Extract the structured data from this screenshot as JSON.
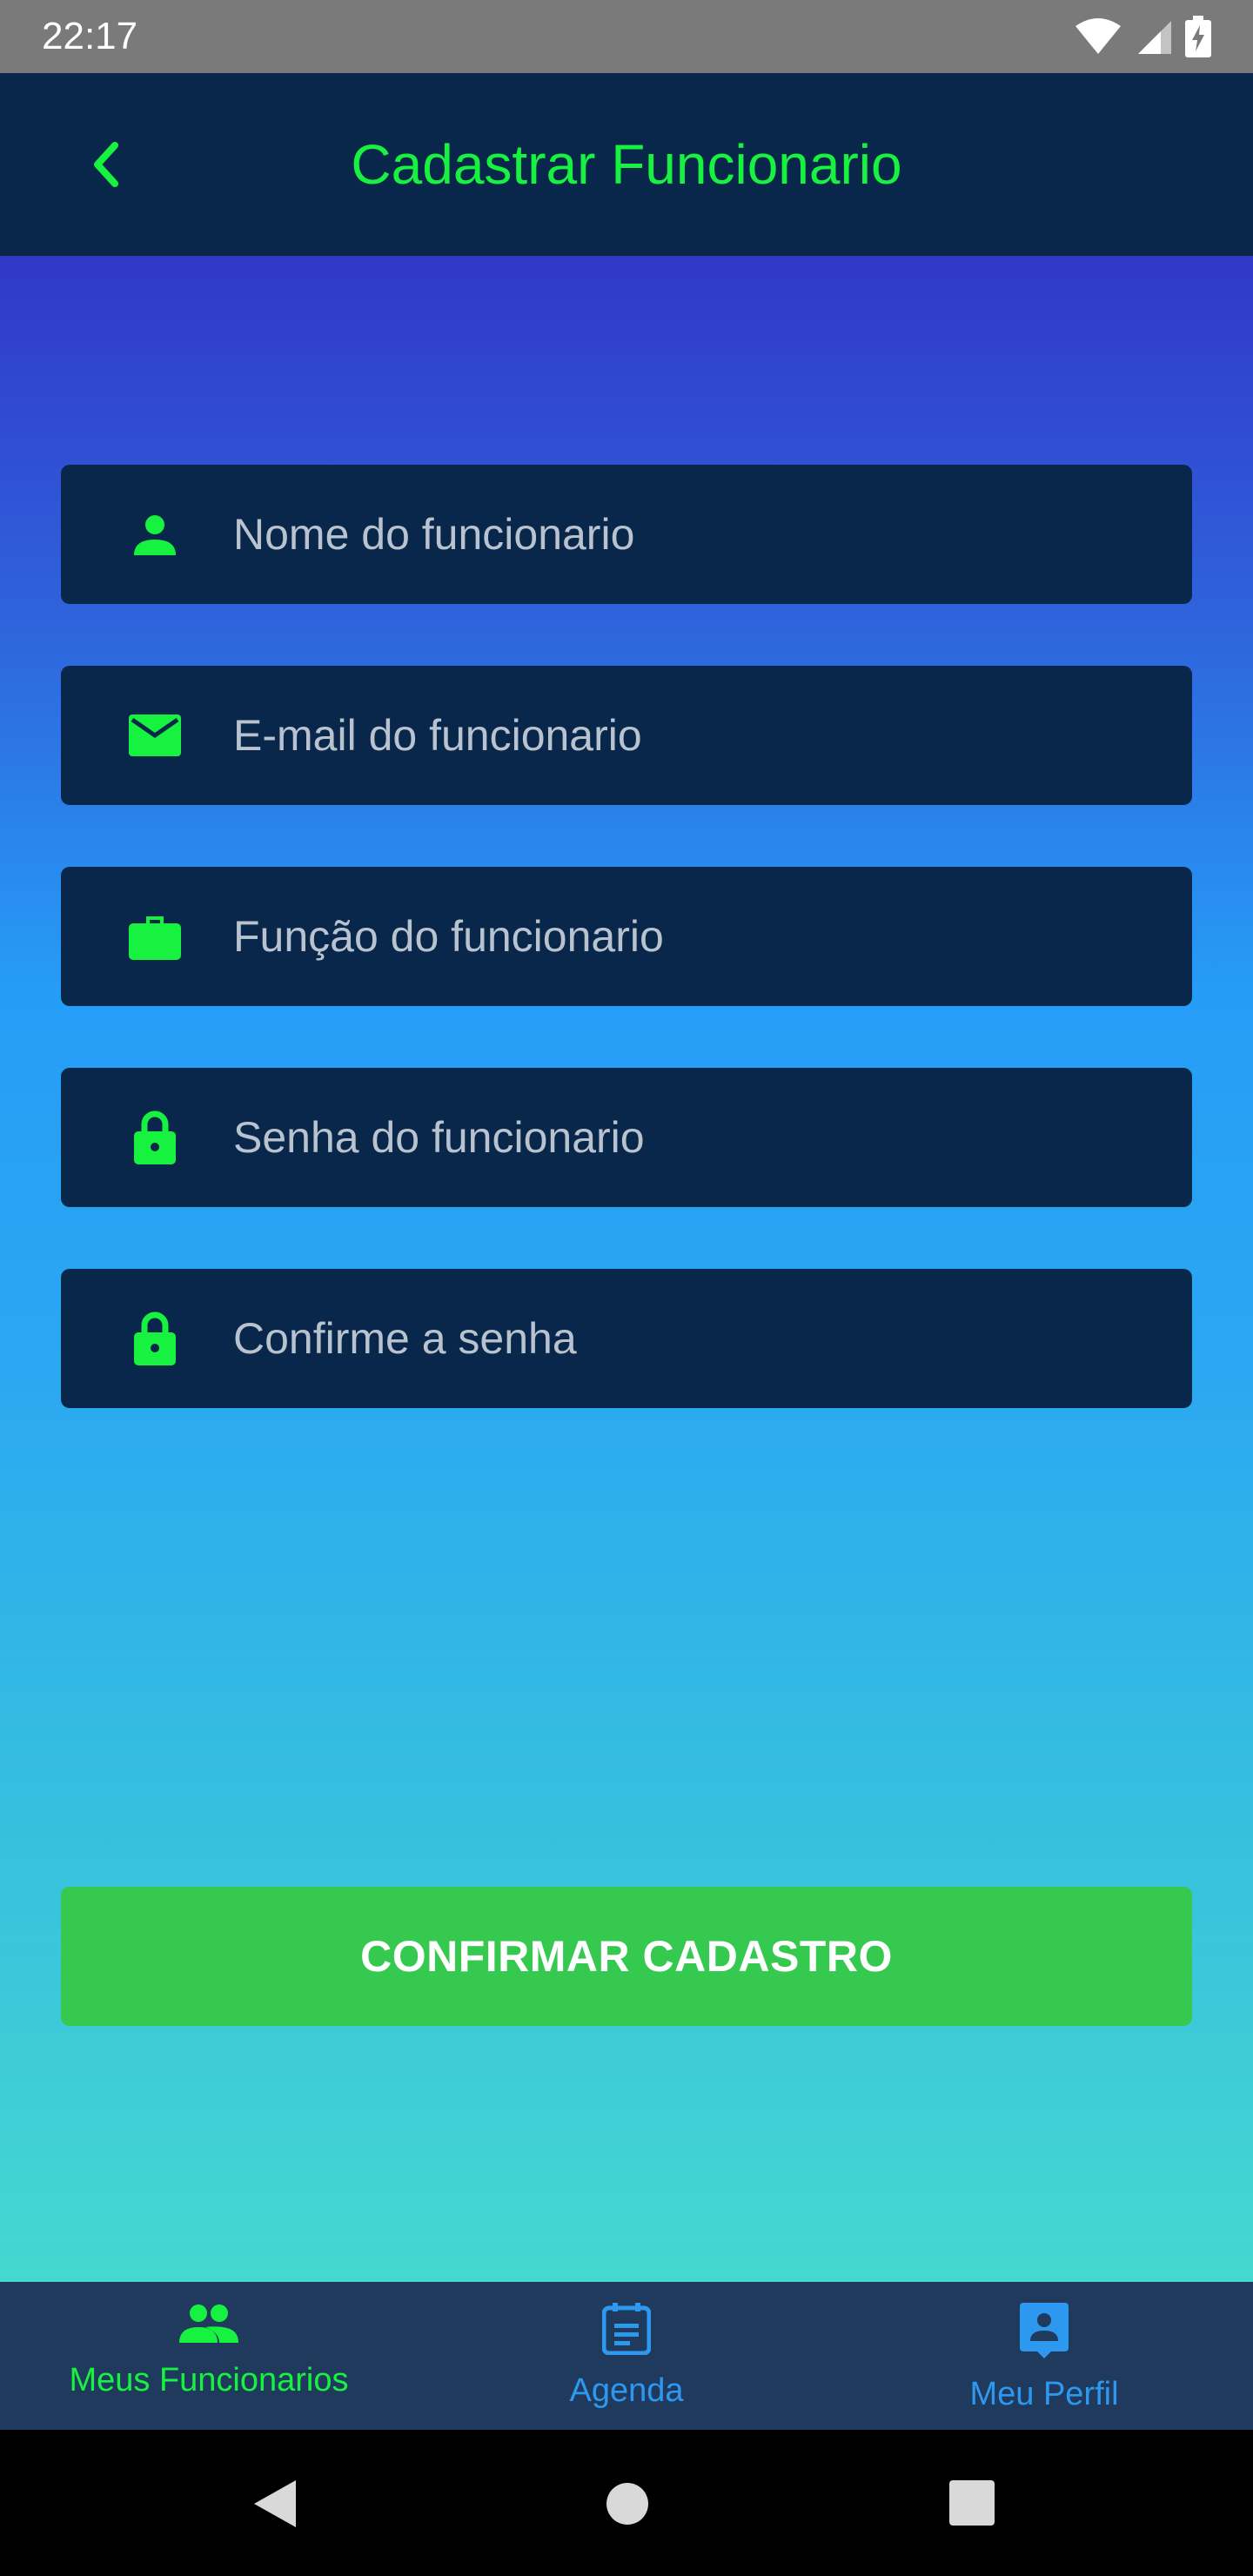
{
  "status_bar": {
    "time": "22:17",
    "icons": [
      "wifi-icon",
      "signal-icon",
      "battery-charging-icon"
    ]
  },
  "app_bar": {
    "back_icon": "chevron-left-icon",
    "title": "Cadastrar Funcionario"
  },
  "form": {
    "fields": [
      {
        "icon": "person-icon",
        "placeholder": "Nome do funcionario",
        "value": ""
      },
      {
        "icon": "mail-icon",
        "placeholder": "E-mail do funcionario",
        "value": ""
      },
      {
        "icon": "briefcase-icon",
        "placeholder": "Função do funcionario",
        "value": ""
      },
      {
        "icon": "lock-icon",
        "placeholder": "Senha do funcionario",
        "value": ""
      },
      {
        "icon": "lock-icon",
        "placeholder": "Confirme a senha",
        "value": ""
      }
    ],
    "confirm_label": "CONFIRMAR CADASTRO"
  },
  "bottom_nav": {
    "items": [
      {
        "label": "Meus Funcionarios",
        "icon": "people-icon",
        "active": true
      },
      {
        "label": "Agenda",
        "icon": "calendar-icon",
        "active": false
      },
      {
        "label": "Meu Perfil",
        "icon": "profile-icon",
        "active": false
      }
    ]
  },
  "system_nav": {
    "icons": [
      "back-triangle-icon",
      "home-circle-icon",
      "recents-square-icon"
    ]
  },
  "colors": {
    "accent_green": "#17f240",
    "navy": "#09274a",
    "button_green": "#36c950",
    "nav_inactive": "#2d98f0"
  }
}
